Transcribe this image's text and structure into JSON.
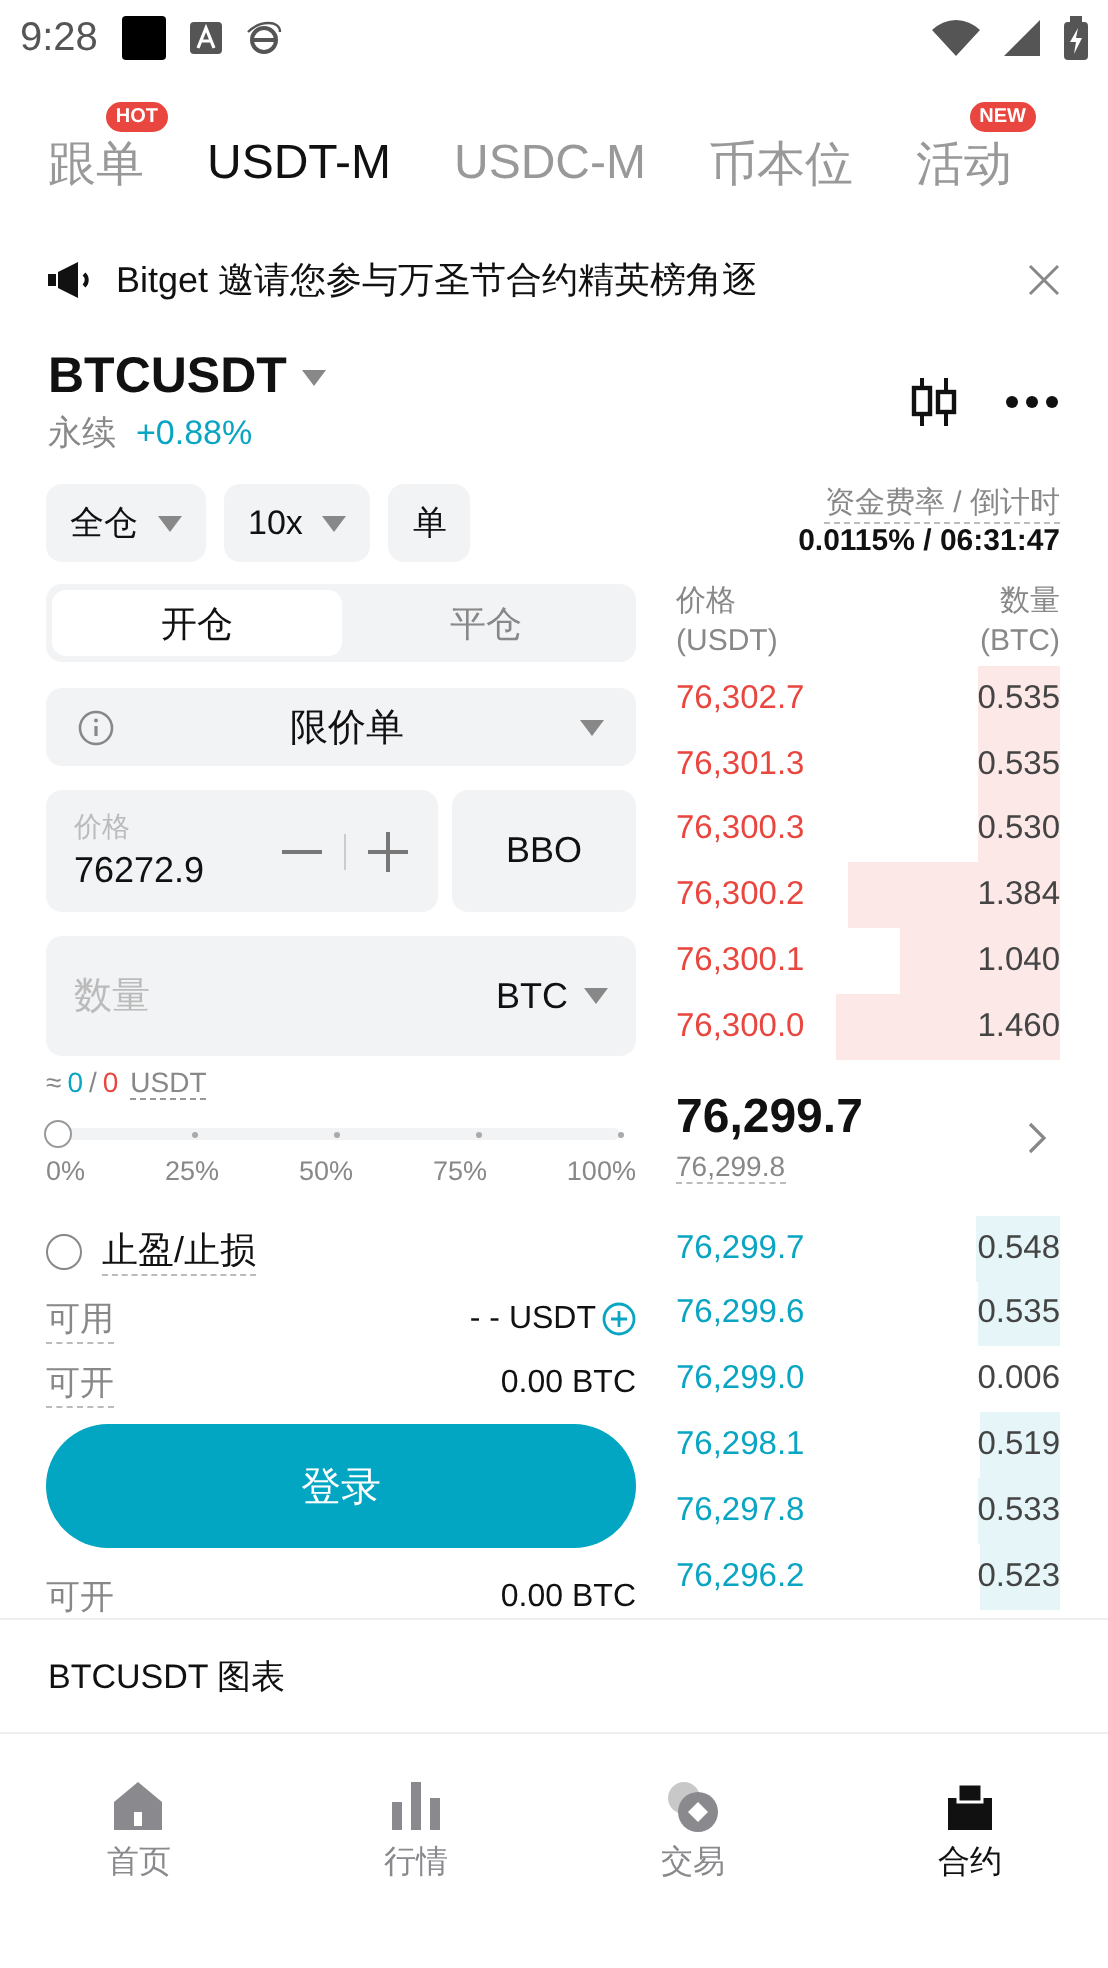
{
  "status_bar": {
    "time": "9:28"
  },
  "tabs": [
    {
      "label": "跟单",
      "selected": false,
      "badge": "HOT"
    },
    {
      "label": "USDT-M",
      "selected": true
    },
    {
      "label": "USDC-M",
      "selected": false
    },
    {
      "label": "币本位",
      "selected": false
    },
    {
      "label": "活动",
      "selected": false,
      "badge": "NEW"
    }
  ],
  "notice": {
    "text": "Bitget 邀请您参与万圣节合约精英榜角逐"
  },
  "symbol": {
    "name": "BTCUSDT",
    "type": "永续",
    "change": "+0.88%"
  },
  "controls": {
    "margin_mode": "全仓",
    "leverage": "10x",
    "position_mode": "单"
  },
  "funding": {
    "label": "资金费率 / 倒计时",
    "value": "0.0115% / 06:31:47"
  },
  "side_tabs": [
    {
      "label": "开仓",
      "selected": true
    },
    {
      "label": "平仓",
      "selected": false
    }
  ],
  "order_type": "限价单",
  "price_field": {
    "label": "价格",
    "value": "76272.9",
    "bbo": "BBO"
  },
  "quantity_field": {
    "placeholder": "数量",
    "unit": "BTC"
  },
  "estimate": {
    "prefix": "≈",
    "long": "0",
    "sep": "/",
    "short": "0",
    "unit": "USDT"
  },
  "slider": {
    "level": 0,
    "marks": [
      "0%",
      "25%",
      "50%",
      "75%",
      "100%"
    ]
  },
  "tp_sl": {
    "label": "止盈/止损",
    "checked": false
  },
  "available": {
    "label": "可用",
    "value": "- - USDT"
  },
  "openable": {
    "label": "可开",
    "value": "0.00 BTC"
  },
  "login_button": "登录",
  "openable_short": {
    "label": "可开",
    "value": "0.00 BTC"
  },
  "order_book": {
    "price_header": "价格",
    "price_unit": "(USDT)",
    "qty_header": "数量",
    "qty_unit": "(BTC)",
    "asks": [
      {
        "price": "76,302.7",
        "qty": "0.535"
      },
      {
        "price": "76,301.3",
        "qty": "0.535"
      },
      {
        "price": "76,300.3",
        "qty": "0.530"
      },
      {
        "price": "76,300.2",
        "qty": "1.384"
      },
      {
        "price": "76,300.1",
        "qty": "1.040"
      },
      {
        "price": "76,300.0",
        "qty": "1.460"
      }
    ],
    "last_price": "76,299.7",
    "mark_price": "76,299.8",
    "bids": [
      {
        "price": "76,299.7",
        "qty": "0.548"
      },
      {
        "price": "76,299.6",
        "qty": "0.535"
      },
      {
        "price": "76,299.0",
        "qty": "0.006"
      },
      {
        "price": "76,298.1",
        "qty": "0.519"
      },
      {
        "price": "76,297.8",
        "qty": "0.533"
      },
      {
        "price": "76,296.2",
        "qty": "0.523"
      }
    ]
  },
  "chart_link": "BTCUSDT 图表",
  "bottom_nav": [
    {
      "label": "首页",
      "kind": "home",
      "selected": false
    },
    {
      "label": "行情",
      "kind": "markets",
      "selected": false
    },
    {
      "label": "交易",
      "kind": "trade",
      "selected": false
    },
    {
      "label": "合约",
      "kind": "futures",
      "selected": true
    }
  ]
}
